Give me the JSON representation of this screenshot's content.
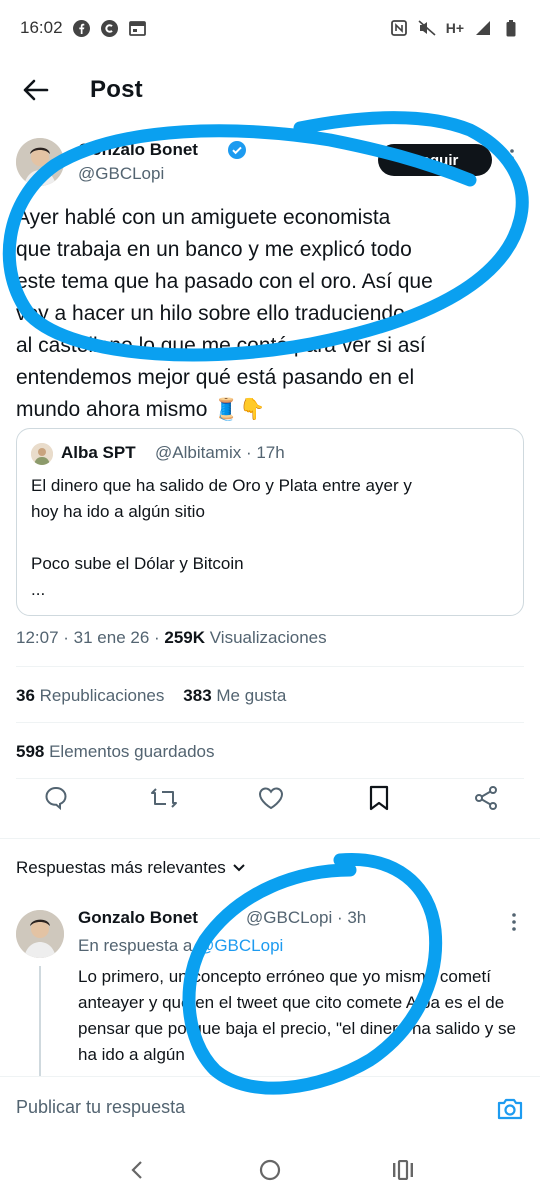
{
  "status_bar": {
    "time": "16:02",
    "network": "H+",
    "icons": [
      "facebook-icon",
      "c-app-icon",
      "calendar-icon",
      "nfc-icon",
      "mute-icon",
      "signal-icon",
      "battery-icon"
    ]
  },
  "header": {
    "title": "Post",
    "back_icon": "arrow-left-icon"
  },
  "post": {
    "author_name": "Gonzalo Bonet",
    "author_handle": "@GBCLopi",
    "follow_label": "Seguir",
    "lines": [
      "Ayer hablé con un amiguete economista",
      "que trabaja en un banco y me explicó todo",
      "este tema que ha pasado con el oro. Así que",
      "voy a hacer un hilo sobre ello traduciendo",
      "al castellano lo que me contó para ver si así",
      "entendemos mejor qué está pasando en el",
      "mundo ahora mismo 🧵👇"
    ],
    "quote": {
      "name": "Alba SPT",
      "meta": "@Albitamix · 17h",
      "text": "El dinero que ha salido de Oro y Plata entre ayer y\nhoy ha ido a algún sitio\n\nPoco sube el Dólar y Bitcoin\n..."
    },
    "time": "12:07 · 31 ene 26 · ",
    "views_count": "259K",
    "views_label": " Visualizaciones",
    "reposts_count": "36",
    "reposts_label": " Republicaciones",
    "likes_count": "383",
    "likes_label": " Me gusta",
    "bookmarks_count": "598",
    "bookmarks_label": " Elementos guardados"
  },
  "replies": {
    "filter_label": "Respuestas más relevantes",
    "items": [
      {
        "name": "Gonzalo Bonet",
        "meta": "@GBCLopi · 3h",
        "reply_to_prefix": "En respuesta a ",
        "reply_to_handle": "@GBCLopi",
        "text": "Lo primero, un concepto erróneo que yo mismo cometí anteayer y que en el tweet que cito comete Alba es el de pensar que porque baja el precio, \"el dinero ha salido y se ha ido a algún"
      }
    ]
  },
  "compose": {
    "placeholder": "Publicar tu respuesta"
  },
  "colors": {
    "accent": "#1d9bf0",
    "annotation": "#0aa0f0",
    "text": "#0f1419",
    "muted": "#536471"
  }
}
